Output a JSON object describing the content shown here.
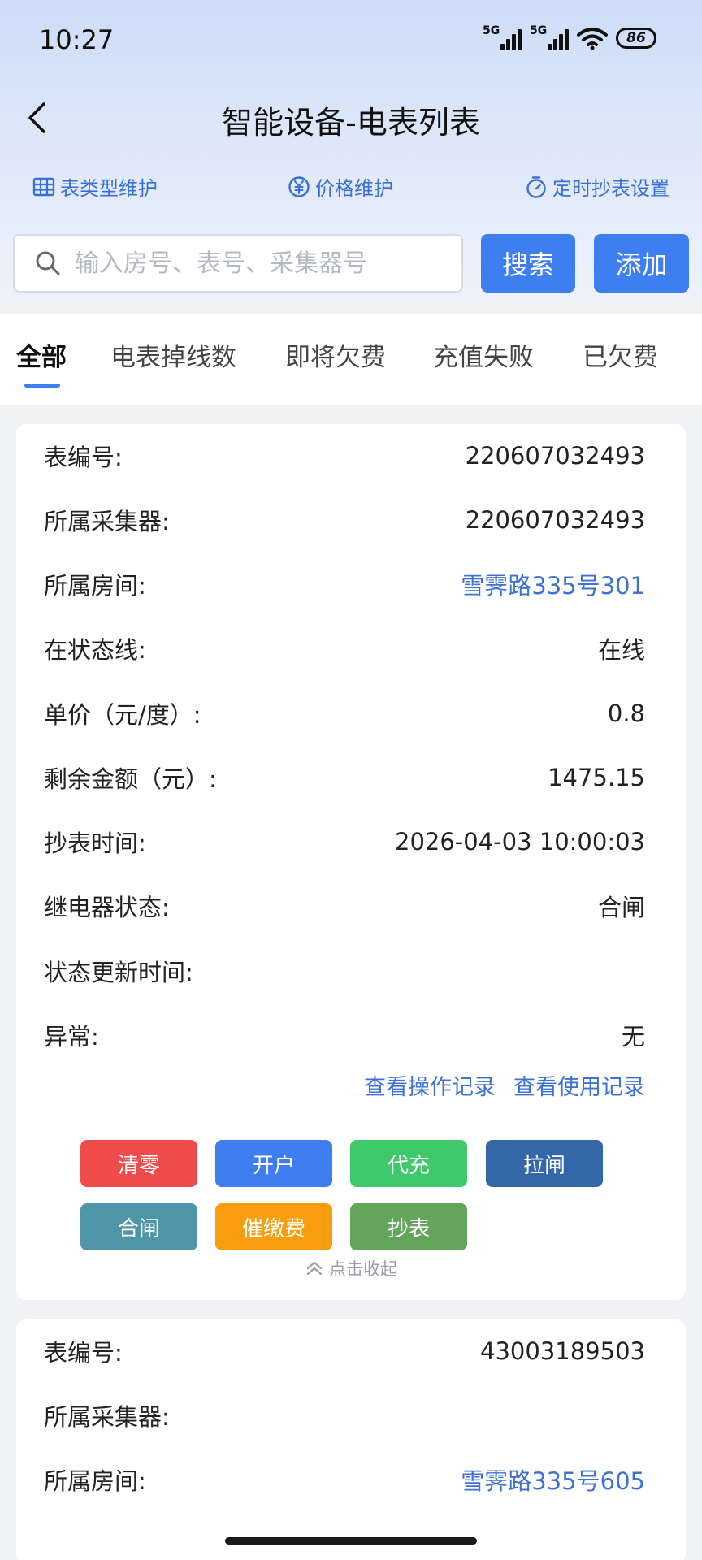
{
  "status_bar": {
    "time": "10:27",
    "network_1": "5G",
    "network_2": "5G",
    "battery": "86"
  },
  "nav": {
    "title": "智能设备-电表列表"
  },
  "quick_links": [
    {
      "label": "表类型维护",
      "icon": "table-icon"
    },
    {
      "label": "价格维护",
      "icon": "yen-icon"
    },
    {
      "label": "定时抄表设置",
      "icon": "timer-icon"
    }
  ],
  "search": {
    "placeholder": "输入房号、表号、采集器号",
    "value": "",
    "search_label": "搜索",
    "add_label": "添加"
  },
  "tabs": [
    "全部",
    "电表掉线数",
    "即将欠费",
    "充值失败",
    "已欠费"
  ],
  "active_tab": "全部",
  "meters": [
    {
      "fields": [
        {
          "label": "表编号:",
          "value": "220607032493"
        },
        {
          "label": "所属采集器:",
          "value": "220607032493"
        },
        {
          "label": "所属房间:",
          "value": "雪霁路335号301"
        },
        {
          "label": "在状态线:",
          "value": "在线"
        },
        {
          "label": "单价（元/度）:",
          "value": "0.8"
        },
        {
          "label": "剩余金额（元）:",
          "value": "1475.15"
        },
        {
          "label": "抄表时间:",
          "value": "2026-04-03 10:00:03"
        },
        {
          "label": "继电器状态:",
          "value": "合闸"
        },
        {
          "label": "状态更新时间:",
          "value": ""
        },
        {
          "label": "异常:",
          "value": "无"
        }
      ],
      "view_ops_label": "查看操作记录",
      "view_usage_label": "查看使用记录",
      "actions": [
        {
          "label": "清零",
          "color": "#f14c4c"
        },
        {
          "label": "开户",
          "color": "#3f7ef1"
        },
        {
          "label": "代充",
          "color": "#3fc96b"
        },
        {
          "label": "拉闸",
          "color": "#3467a8"
        },
        {
          "label": "合闸",
          "color": "#5096a8"
        },
        {
          "label": "催缴费",
          "color": "#f79d0e"
        },
        {
          "label": "抄表",
          "color": "#63a55a"
        }
      ],
      "collapse_label": "点击收起"
    },
    {
      "fields": [
        {
          "label": "表编号:",
          "value": "43003189503"
        },
        {
          "label": "所属采集器:",
          "value": ""
        },
        {
          "label": "所属房间:",
          "value": "雪霁路335号605"
        }
      ]
    }
  ],
  "colors": {
    "accent": "#3d7ef0",
    "link": "#3d72d4"
  }
}
